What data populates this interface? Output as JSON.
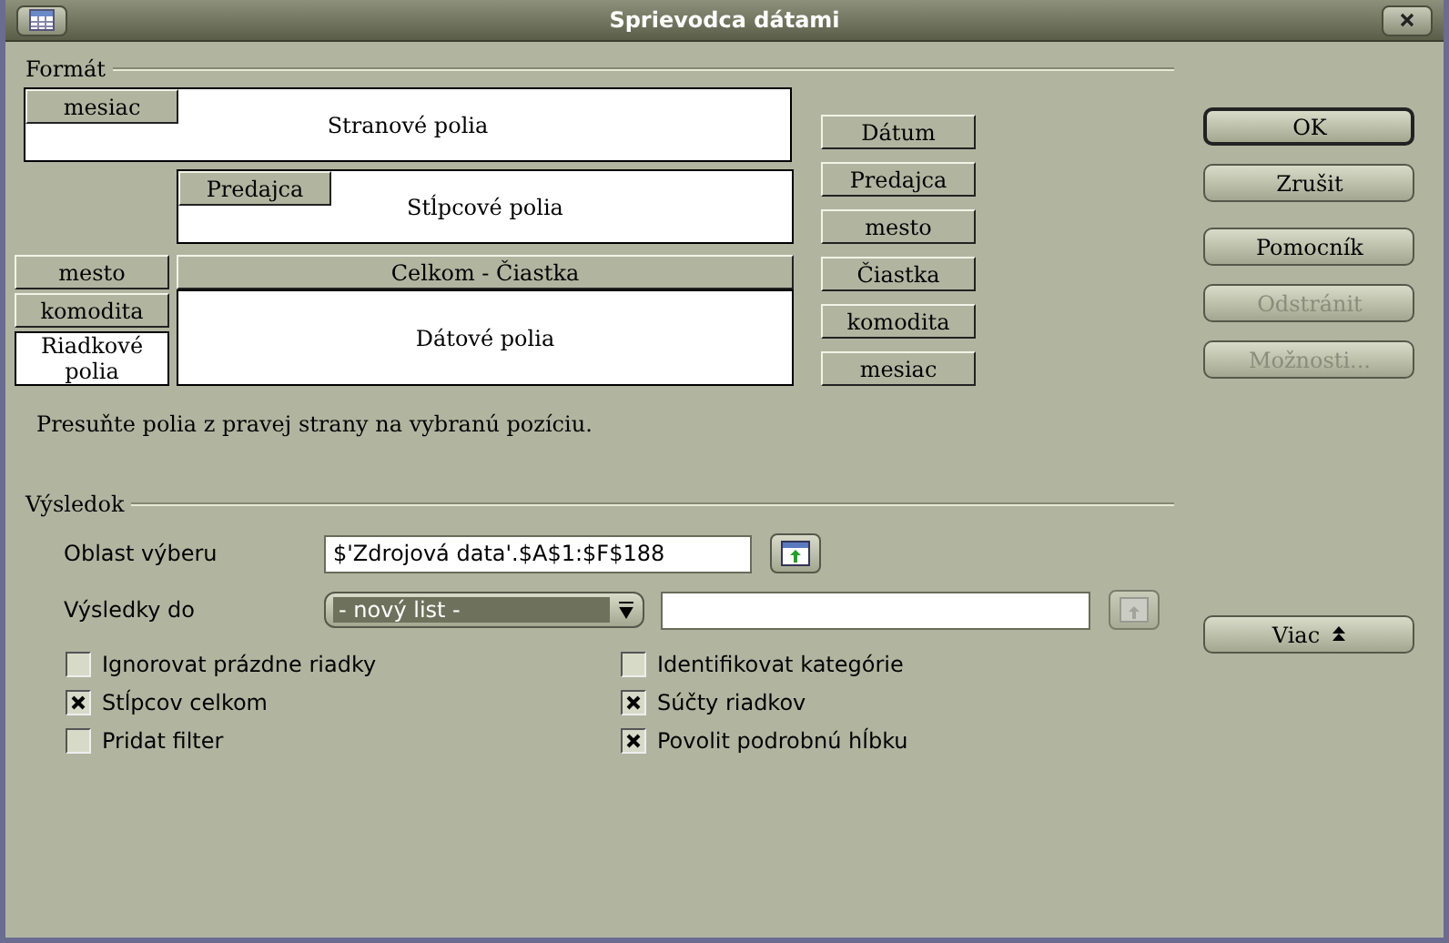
{
  "window": {
    "title": "Sprievodca dátami"
  },
  "layout": {
    "title": "Formát",
    "page_fields": {
      "label": "Stranové polia",
      "fields": [
        "mesiac"
      ]
    },
    "column_fields": {
      "label": "Stĺpcové polia",
      "fields": [
        "Predajca"
      ]
    },
    "row_fields": {
      "label": "Riadkové polia",
      "fields": [
        "mesto",
        "komodita"
      ]
    },
    "data_fields": {
      "label": "Dátové polia",
      "fields": [
        "Celkom - Čiastka"
      ]
    },
    "available_fields": [
      "Dátum",
      "Predajca",
      "mesto",
      "Čiastka",
      "komodita",
      "mesiac"
    ],
    "hint": "Presuňte polia z pravej strany na vybranú pozíciu."
  },
  "buttons": [
    {
      "label": "OK",
      "disabled": false,
      "default": true
    },
    {
      "label": "Zrušit",
      "disabled": false,
      "default": false
    },
    {
      "label": "Pomocník",
      "disabled": false,
      "default": false
    },
    {
      "label": "Odstránit",
      "disabled": true,
      "default": false
    },
    {
      "label": "Možnosti...",
      "disabled": true,
      "default": false
    }
  ],
  "more_button": {
    "label": "Viac"
  },
  "result": {
    "title": "Výsledok",
    "source": {
      "label": "Oblast výberu",
      "value": "$'Zdrojová data'.$A$1:$F$188"
    },
    "destination": {
      "label": "Výsledky do",
      "selection": "- nový list -",
      "shrink_disabled": true
    }
  },
  "options": [
    {
      "label": "Ignorovat prázdne riadky",
      "checked": false
    },
    {
      "label": "Identifikovat kategórie",
      "checked": false
    },
    {
      "label": "Stĺpcov celkom",
      "checked": true
    },
    {
      "label": "Súčty riadkov",
      "checked": true
    },
    {
      "label": "Pridat filter",
      "checked": false
    },
    {
      "label": "Povolit podrobnú hĺbku",
      "checked": true
    }
  ]
}
